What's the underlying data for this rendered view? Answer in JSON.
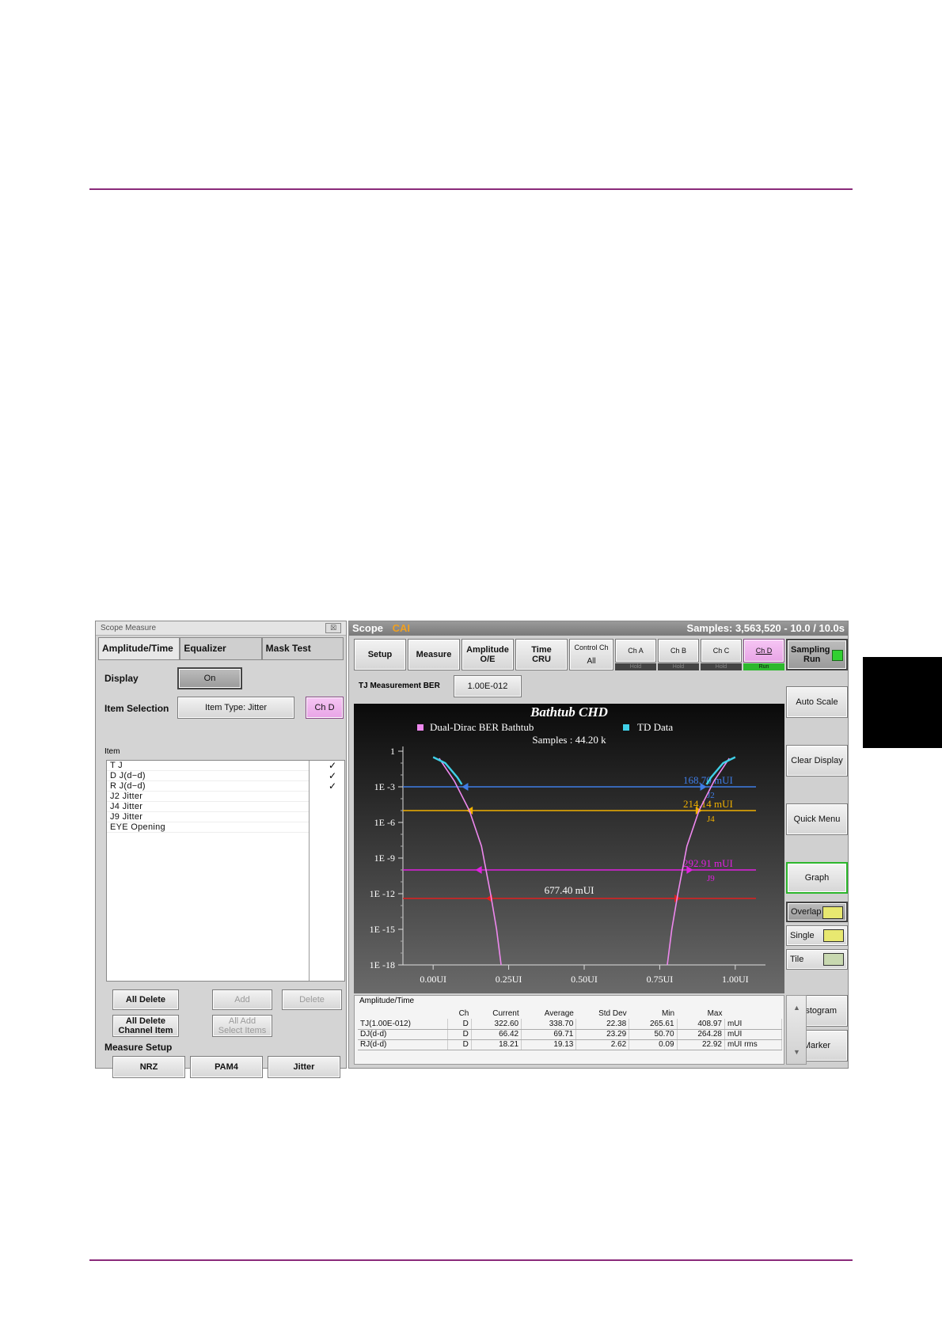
{
  "scope_measure": {
    "title": "Scope Measure",
    "close": "☒",
    "tabs": [
      "Amplitude/Time",
      "Equalizer",
      "Mask Test"
    ],
    "display_label": "Display",
    "display_value": "On",
    "item_selection_label": "Item Selection",
    "item_type": "Item Type: Jitter",
    "channel": "Ch D",
    "item_header": "Item",
    "items": [
      {
        "name": "T J",
        "checked": "✓"
      },
      {
        "name": "D J(d−d)",
        "checked": "✓"
      },
      {
        "name": "R J(d−d)",
        "checked": "✓"
      },
      {
        "name": "J2  Jitter",
        "checked": ""
      },
      {
        "name": "J4  Jitter",
        "checked": ""
      },
      {
        "name": "J9  Jitter",
        "checked": ""
      },
      {
        "name": "EYE Opening",
        "checked": ""
      }
    ],
    "buttons": {
      "all_delete": "All Delete",
      "add": "Add",
      "delete": "Delete",
      "all_delete_channel_1": "All Delete",
      "all_delete_channel_2": "Channel Item",
      "all_add_1": "All Add",
      "all_add_2": "Select Items"
    },
    "measure_setup_label": "Measure Setup",
    "setup_buttons": [
      "NRZ",
      "PAM4",
      "Jitter"
    ]
  },
  "scope": {
    "title": "Scope",
    "mode": "CAI",
    "samples": "Samples: 3,563,520 - 10.0 / 10.0s",
    "toolbar": {
      "setup": "Setup",
      "measure": "Measure",
      "amplitude_1": "Amplitude",
      "amplitude_2": "O/E",
      "time_1": "Time",
      "time_2": "CRU",
      "control_ch_1": "Control Ch",
      "control_ch_2": "All",
      "ch_a": "Ch A",
      "ch_b": "Ch B",
      "ch_c": "Ch C",
      "ch_d": "Ch D",
      "hold": "Hold",
      "run": "Run",
      "sampling_1": "Sampling",
      "sampling_2": "Run"
    },
    "tj_ber_label": "TJ Measurement BER",
    "tj_ber_value": "1.00E-012",
    "side_buttons": {
      "auto_scale": "Auto Scale",
      "clear_display": "Clear Display",
      "quick_menu": "Quick Menu",
      "graph": "Graph",
      "overlap": "Overlap",
      "single": "Single",
      "tile": "Tile",
      "histogram": "Histogram",
      "marker": "Marker"
    },
    "results": {
      "title": "Amplitude/Time",
      "headers": [
        "",
        "Ch",
        "Current",
        "Average",
        "Std Dev",
        "Min",
        "Max",
        ""
      ],
      "rows": [
        [
          "TJ(1.00E-012)",
          "D",
          "322.60",
          "338.70",
          "22.38",
          "265.61",
          "408.97",
          "mUI"
        ],
        [
          "DJ(d-d)",
          "D",
          "66.42",
          "69.71",
          "23.29",
          "50.70",
          "264.28",
          "mUI"
        ],
        [
          "RJ(d-d)",
          "D",
          "18.21",
          "19.13",
          "2.62",
          "0.09",
          "22.92",
          "mUI rms"
        ]
      ]
    }
  },
  "chart_data": {
    "type": "line",
    "title": "Bathtub CHD",
    "legend": [
      "Dual-Dirac BER Bathtub",
      "TD Data"
    ],
    "legend_placement": "top",
    "samples_label": "Samples : 44.20 k",
    "x_ticks": [
      "0.00UI",
      "0.25UI",
      "0.50UI",
      "0.75UI",
      "1.00UI"
    ],
    "xlim": [
      -0.1,
      1.1
    ],
    "y_ticks": [
      "1",
      "1E -3",
      "1E -6",
      "1E -9",
      "1E -12",
      "1E -15",
      "1E -18"
    ],
    "y_exp_range": [
      0,
      -18
    ],
    "y_scale": "log",
    "series": [
      {
        "name": "Dual-Dirac BER Bathtub",
        "left": [
          [
            0.02,
            -0.6
          ],
          [
            0.07,
            -2.5
          ],
          [
            0.12,
            -5
          ],
          [
            0.16,
            -8
          ],
          [
            0.19,
            -12
          ],
          [
            0.21,
            -15
          ],
          [
            0.225,
            -18
          ]
        ],
        "right": [
          [
            0.98,
            -0.6
          ],
          [
            0.93,
            -2.5
          ],
          [
            0.88,
            -5
          ],
          [
            0.84,
            -8
          ],
          [
            0.81,
            -12
          ],
          [
            0.79,
            -15
          ],
          [
            0.775,
            -18
          ]
        ]
      },
      {
        "name": "TD Data",
        "left": [
          [
            0.0,
            -0.5
          ],
          [
            0.04,
            -1.0
          ],
          [
            0.08,
            -2.2
          ],
          [
            0.095,
            -2.8
          ]
        ],
        "right": [
          [
            1.0,
            -0.5
          ],
          [
            0.96,
            -1.0
          ],
          [
            0.92,
            -2.2
          ],
          [
            0.905,
            -2.8
          ]
        ]
      }
    ],
    "levels": [
      {
        "exp": -3,
        "label": "168.70 mUI",
        "tag": "J2",
        "color": "#3f7de6",
        "left": 0.095,
        "right": 0.905
      },
      {
        "exp": -5,
        "label": "214.14 mUI",
        "tag": "J4",
        "color": "#f0b000",
        "left": 0.11,
        "right": 0.89
      },
      {
        "exp": -10,
        "label": "292.91 mUI",
        "tag": "J9",
        "color": "#e020e0",
        "left": 0.14,
        "right": 0.86
      },
      {
        "exp": -12.4,
        "label": "677.40 mUI",
        "tag": "",
        "color": "#e02020",
        "left": 0.175,
        "right": 0.82
      }
    ],
    "colors": {
      "bathtub": "#ee88ee",
      "td": "#40d0e8"
    }
  }
}
